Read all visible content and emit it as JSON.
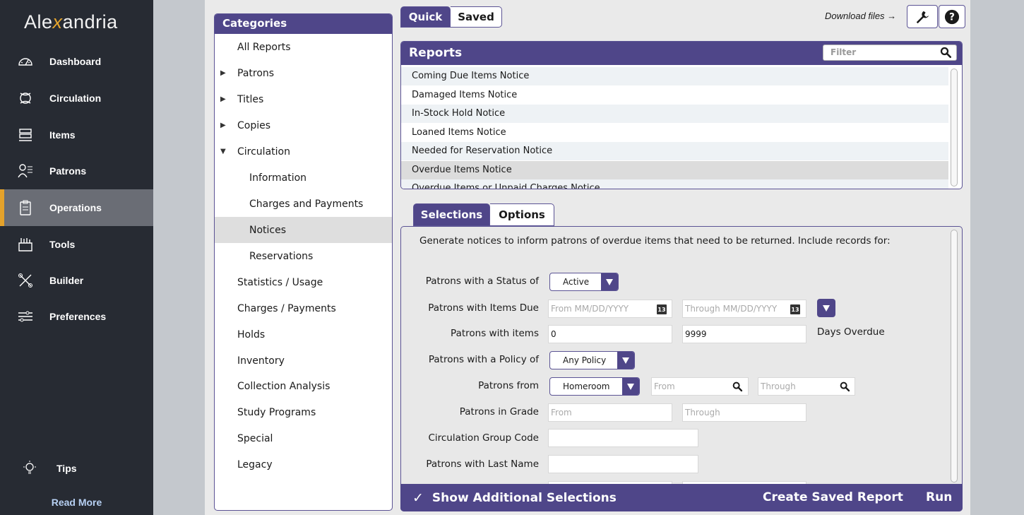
{
  "app": {
    "logo_before": "Ale",
    "logo_x": "x",
    "logo_after": "andria"
  },
  "nav": {
    "items": [
      {
        "label": "Dashboard",
        "icon": "dashboard-icon"
      },
      {
        "label": "Circulation",
        "icon": "circulation-icon"
      },
      {
        "label": "Items",
        "icon": "items-icon"
      },
      {
        "label": "Patrons",
        "icon": "patrons-icon"
      },
      {
        "label": "Operations",
        "icon": "operations-icon",
        "active": true
      },
      {
        "label": "Tools",
        "icon": "tools-icon"
      },
      {
        "label": "Builder",
        "icon": "builder-icon"
      },
      {
        "label": "Preferences",
        "icon": "preferences-icon"
      }
    ],
    "tips": "Tips",
    "read_more": "Read More"
  },
  "categories": {
    "title": "Categories",
    "items": [
      {
        "label": "All Reports",
        "arrow": ""
      },
      {
        "label": "Patrons",
        "arrow": "▶"
      },
      {
        "label": "Titles",
        "arrow": "▶"
      },
      {
        "label": "Copies",
        "arrow": "▶"
      },
      {
        "label": "Circulation",
        "arrow": "▼"
      },
      {
        "label": "Information",
        "sub": true
      },
      {
        "label": "Charges and Payments",
        "sub": true
      },
      {
        "label": "Notices",
        "sub": true,
        "selected": true
      },
      {
        "label": "Reservations",
        "sub": true
      },
      {
        "label": "Statistics / Usage"
      },
      {
        "label": "Charges / Payments"
      },
      {
        "label": "Holds"
      },
      {
        "label": "Inventory"
      },
      {
        "label": "Collection Analysis"
      },
      {
        "label": "Study Programs"
      },
      {
        "label": "Special"
      },
      {
        "label": "Legacy"
      }
    ]
  },
  "top_tabs": {
    "quick": "Quick",
    "saved": "Saved"
  },
  "download_files": "Download files →",
  "reports": {
    "title": "Reports",
    "filter_placeholder": "Filter",
    "rows": [
      "Coming Due Items Notice",
      "Damaged Items Notice",
      "In-Stock Hold Notice",
      "Loaned Items Notice",
      "Needed for Reservation Notice",
      "Overdue Items Notice",
      "Overdue Items or Unpaid Charges Notice"
    ],
    "selected": "Overdue Items Notice"
  },
  "sub_tabs": {
    "selections": "Selections",
    "options": "Options"
  },
  "selections": {
    "description": "Generate notices to inform patrons of overdue items that need to be returned. Include records for:",
    "status_label": "Patrons with a Status of",
    "status_value": "Active",
    "items_due_label": "Patrons with Items Due",
    "items_due_from_placeholder": "From MM/DD/YYYY",
    "items_due_through_placeholder": "Through MM/DD/YYYY",
    "calendar_glyph": "13",
    "with_items_label": "Patrons with items",
    "with_items_from": "0",
    "with_items_to": "9999",
    "days_overdue": "Days Overdue",
    "policy_label": "Patrons with a Policy of",
    "policy_value": "Any Policy",
    "from_label": "Patrons from",
    "from_value": "Homeroom",
    "from_placeholder": "From",
    "through_placeholder": "Through",
    "grade_label": "Patrons in Grade",
    "grade_from_placeholder": "From",
    "grade_through_placeholder": "Through",
    "group_code_label": "Circulation Group Code",
    "last_name_label": "Patrons with Last Name"
  },
  "footer": {
    "checkmark": "✓",
    "show_additional": "Show Additional Selections",
    "create_saved": "Create Saved Report",
    "run": "Run"
  },
  "colors": {
    "purple": "#4f4689",
    "nav_bg": "#272b33",
    "accent": "#e4a22b"
  }
}
